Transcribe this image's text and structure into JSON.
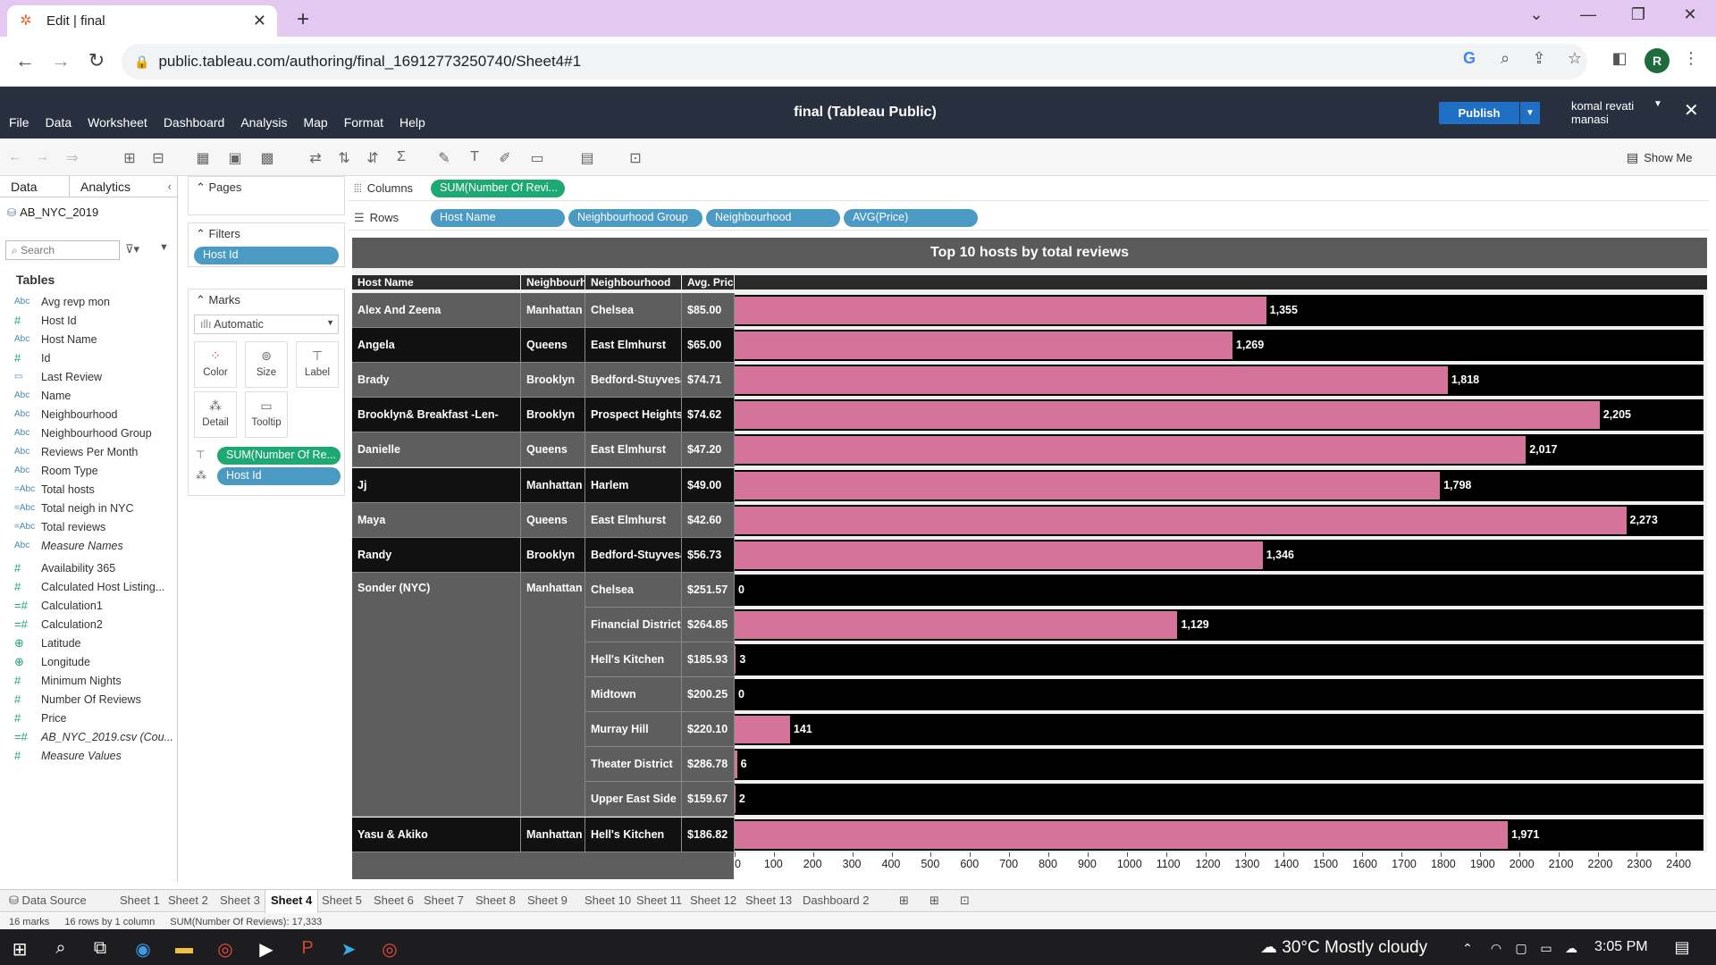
{
  "browser": {
    "tab_title": "Edit | final",
    "new_tab": "+",
    "url": "public.tableau.com/authoring/final_16912773250740/Sheet4#1",
    "profile_initial": "R"
  },
  "app": {
    "menus": [
      "File",
      "Data",
      "Worksheet",
      "Dashboard",
      "Analysis",
      "Map",
      "Format",
      "Help"
    ],
    "title": "final (Tableau Public)",
    "publish_label": "Publish",
    "user_line1": "komal revati",
    "user_line2": "manasi",
    "show_me": "Show Me"
  },
  "data_pane": {
    "tab_data": "Data",
    "tab_analytics": "Analytics",
    "source": "AB_NYC_2019",
    "search_placeholder": "Search",
    "tables_heading": "Tables",
    "fields": [
      {
        "type": "Abc",
        "name": "Avg revp mon",
        "kind": "dim"
      },
      {
        "type": "#",
        "name": "Host Id",
        "kind": "measure"
      },
      {
        "type": "Abc",
        "name": "Host Name",
        "kind": "dim"
      },
      {
        "type": "#",
        "name": "Id",
        "kind": "measure"
      },
      {
        "type": "▭",
        "name": "Last Review",
        "kind": "dim"
      },
      {
        "type": "Abc",
        "name": "Name",
        "kind": "dim"
      },
      {
        "type": "Abc",
        "name": "Neighbourhood",
        "kind": "dim"
      },
      {
        "type": "Abc",
        "name": "Neighbourhood Group",
        "kind": "dim"
      },
      {
        "type": "Abc",
        "name": "Reviews Per Month",
        "kind": "dim"
      },
      {
        "type": "Abc",
        "name": "Room Type",
        "kind": "dim"
      },
      {
        "type": "=Abc",
        "name": "Total hosts",
        "kind": "dim"
      },
      {
        "type": "=Abc",
        "name": "Total neigh in NYC",
        "kind": "dim"
      },
      {
        "type": "=Abc",
        "name": "Total reviews",
        "kind": "dim"
      },
      {
        "type": "Abc",
        "name": "Measure Names",
        "kind": "dim",
        "italic": true
      },
      {
        "type": "#",
        "name": "Availability 365",
        "kind": "measure"
      },
      {
        "type": "#",
        "name": "Calculated Host Listing...",
        "kind": "measure"
      },
      {
        "type": "=#",
        "name": "Calculation1",
        "kind": "measure"
      },
      {
        "type": "=#",
        "name": "Calculation2",
        "kind": "measure"
      },
      {
        "type": "⊕",
        "name": "Latitude",
        "kind": "measure"
      },
      {
        "type": "⊕",
        "name": "Longitude",
        "kind": "measure"
      },
      {
        "type": "#",
        "name": "Minimum Nights",
        "kind": "measure"
      },
      {
        "type": "#",
        "name": "Number Of Reviews",
        "kind": "measure"
      },
      {
        "type": "#",
        "name": "Price",
        "kind": "measure"
      },
      {
        "type": "=#",
        "name": "AB_NYC_2019.csv (Cou...",
        "kind": "measure",
        "italic": true
      },
      {
        "type": "#",
        "name": "Measure Values",
        "kind": "measure",
        "italic": true
      }
    ]
  },
  "cards": {
    "pages": "Pages",
    "filters": "Filters",
    "filter_pill": "Host Id",
    "marks": "Marks",
    "mark_type": "Automatic",
    "buttons": [
      "Color",
      "Size",
      "Label",
      "Detail",
      "Tooltip"
    ],
    "mark_pill_1": "SUM(Number Of Re...",
    "mark_pill_2": "Host Id"
  },
  "shelves": {
    "columns_label": "Columns",
    "rows_label": "Rows",
    "column_pills": [
      "SUM(Number Of Revi..."
    ],
    "row_pills": [
      "Host Name",
      "Neighbourhood Group",
      "Neighbourhood",
      "AVG(Price)"
    ]
  },
  "chart_data": {
    "type": "bar",
    "title": "Top 10 hosts by total reviews",
    "headers": [
      "Host Name",
      "Neighbourho..",
      "Neighbourhood",
      "Avg. Price"
    ],
    "xlim": [
      0,
      2470
    ],
    "ticks": [
      0,
      100,
      200,
      300,
      400,
      500,
      600,
      700,
      800,
      900,
      1000,
      1100,
      1200,
      1300,
      1400,
      1500,
      1600,
      1700,
      1800,
      1900,
      2000,
      2100,
      2200,
      2300,
      2400
    ],
    "rows": [
      {
        "host": "Alex And Zeena",
        "group": "Manhattan",
        "neighbourhood": "Chelsea",
        "price": "$85.00",
        "value": 1355,
        "label": "1,355"
      },
      {
        "host": "Angela",
        "group": "Queens",
        "neighbourhood": "East Elmhurst",
        "price": "$65.00",
        "value": 1269,
        "label": "1,269"
      },
      {
        "host": "Brady",
        "group": "Brooklyn",
        "neighbourhood": "Bedford-Stuyvesant",
        "price": "$74.71",
        "value": 1818,
        "label": "1,818"
      },
      {
        "host": "Brooklyn&  Breakfast   -Len-",
        "group": "Brooklyn",
        "neighbourhood": "Prospect Heights",
        "price": "$74.62",
        "value": 2205,
        "label": "2,205"
      },
      {
        "host": "Danielle",
        "group": "Queens",
        "neighbourhood": "East Elmhurst",
        "price": "$47.20",
        "value": 2017,
        "label": "2,017"
      },
      {
        "host": "Jj",
        "group": "Manhattan",
        "neighbourhood": "Harlem",
        "price": "$49.00",
        "value": 1798,
        "label": "1,798"
      },
      {
        "host": "Maya",
        "group": "Queens",
        "neighbourhood": "East Elmhurst",
        "price": "$42.60",
        "value": 2273,
        "label": "2,273"
      },
      {
        "host": "Randy",
        "group": "Brooklyn",
        "neighbourhood": "Bedford-Stuyvesant",
        "price": "$56.73",
        "value": 1346,
        "label": "1,346"
      },
      {
        "host": "Sonder (NYC)",
        "group": "Manhattan",
        "neighbourhood": "Chelsea",
        "price": "$251.57",
        "value": 0,
        "label": "0"
      },
      {
        "host": "Sonder (NYC)",
        "group": "Manhattan",
        "neighbourhood": "Financial District",
        "price": "$264.85",
        "value": 1129,
        "label": "1,129"
      },
      {
        "host": "Sonder (NYC)",
        "group": "Manhattan",
        "neighbourhood": "Hell's Kitchen",
        "price": "$185.93",
        "value": 3,
        "label": "3"
      },
      {
        "host": "Sonder (NYC)",
        "group": "Manhattan",
        "neighbourhood": "Midtown",
        "price": "$200.25",
        "value": 0,
        "label": "0"
      },
      {
        "host": "Sonder (NYC)",
        "group": "Manhattan",
        "neighbourhood": "Murray Hill",
        "price": "$220.10",
        "value": 141,
        "label": "141"
      },
      {
        "host": "Sonder (NYC)",
        "group": "Manhattan",
        "neighbourhood": "Theater District",
        "price": "$286.78",
        "value": 6,
        "label": "6"
      },
      {
        "host": "Sonder (NYC)",
        "group": "Manhattan",
        "neighbourhood": "Upper East Side",
        "price": "$159.67",
        "value": 2,
        "label": "2"
      },
      {
        "host": "Yasu & Akiko",
        "group": "Manhattan",
        "neighbourhood": "Hell's Kitchen",
        "price": "$186.82",
        "value": 1971,
        "label": "1,971"
      }
    ]
  },
  "sheet_tabs": {
    "data_source": "Data Source",
    "sheets": [
      "Sheet 1",
      "Sheet 2",
      "Sheet 3",
      "Sheet 4",
      "Sheet 5",
      "Sheet 6",
      "Sheet 7",
      "Sheet 8",
      "Sheet 9",
      "Sheet 10",
      "Sheet 11",
      "Sheet 12",
      "Sheet 13",
      "Dashboard 2"
    ],
    "active": "Sheet 4"
  },
  "status": {
    "marks": "16 marks",
    "rows": "16 rows by 1 column",
    "sum": "SUM(Number Of Reviews): 17,333"
  },
  "taskbar": {
    "weather": "30°C  Mostly cloudy",
    "time": "3:05 PM"
  },
  "colors": {
    "bar": "#d4749a",
    "header_bg": "#283040",
    "green_pill": "#1ea873",
    "blue_pill": "#4a9ac4",
    "publish": "#1f6fc5"
  }
}
